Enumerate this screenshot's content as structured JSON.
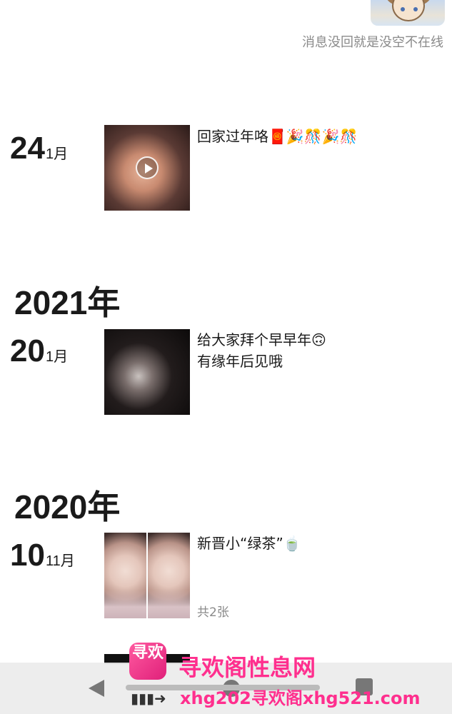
{
  "profile": {
    "signature": "消息没回就是没空不在线"
  },
  "posts": [
    {
      "day": "24",
      "month": "1月",
      "caption": "回家过年咯🧧🎉🎊🎉🎊",
      "count": ""
    },
    {
      "day": "20",
      "month": "1月",
      "caption": "给大家拜个早早年🙃\n有缘年后见哦",
      "count": ""
    },
    {
      "day": "10",
      "month": "11月",
      "caption": "新晋小“绿茶”🍵",
      "count": "共2张"
    }
  ],
  "years": [
    "2021年",
    "2020年"
  ],
  "watermark": {
    "logo_text": "寻欢",
    "title": "寻欢阁性息网",
    "url": "xhg202寻欢阁xhg521.com"
  },
  "icons": {
    "video": "play-icon",
    "back": "back-icon",
    "home": "home-icon",
    "recent": "recent-apps-icon"
  }
}
